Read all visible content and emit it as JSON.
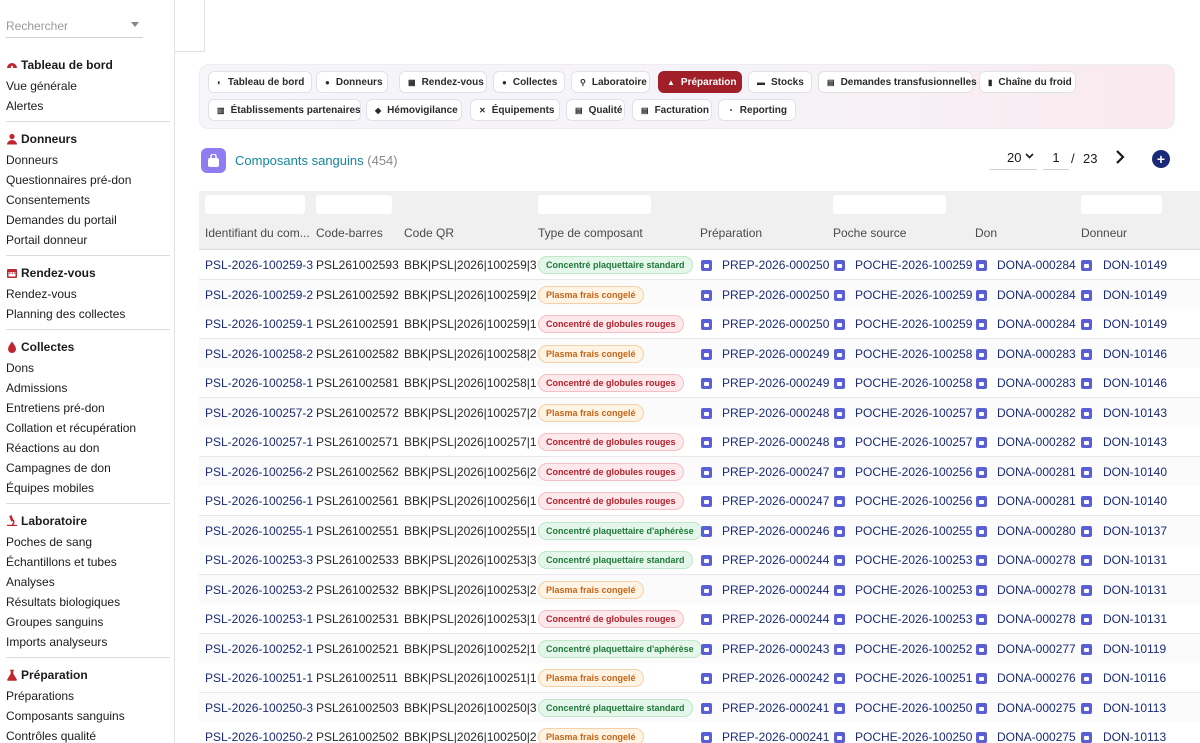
{
  "sidebar": {
    "search_placeholder": "Rechercher",
    "sections": [
      {
        "title": "Tableau de bord",
        "icon": "dashboard-icon",
        "items": [
          "Vue générale",
          "Alertes"
        ]
      },
      {
        "title": "Donneurs",
        "icon": "user-icon",
        "items": [
          "Donneurs",
          "Questionnaires pré-don",
          "Consentements",
          "Demandes du portail",
          "Portail donneur"
        ]
      },
      {
        "title": "Rendez-vous",
        "icon": "calendar-icon",
        "items": [
          "Rendez-vous",
          "Planning des collectes"
        ]
      },
      {
        "title": "Collectes",
        "icon": "drop-icon",
        "items": [
          "Dons",
          "Admissions",
          "Entretiens pré-don",
          "Collation et récupération",
          "Réactions au don",
          "Campagnes de don",
          "Équipes mobiles"
        ]
      },
      {
        "title": "Laboratoire",
        "icon": "microscope-icon",
        "items": [
          "Poches de sang",
          "Échantillons et tubes",
          "Analyses",
          "Résultats biologiques",
          "Groupes sanguins",
          "Imports analyseurs"
        ]
      },
      {
        "title": "Préparation",
        "icon": "flask-icon",
        "items": [
          "Préparations",
          "Composants sanguins",
          "Contrôles qualité"
        ]
      }
    ]
  },
  "nav": {
    "row1": [
      "Tableau de bord",
      "Donneurs",
      "Rendez-vous",
      "Collectes",
      "Laboratoire",
      "Préparation",
      "Stocks",
      "Demandes transfusionnelles",
      "Chaîne du froid"
    ],
    "row2": [
      "Établissements partenaires",
      "Hémovigilance",
      "Équipements",
      "Qualité",
      "Facturation",
      "Reporting"
    ],
    "active": "Préparation"
  },
  "page": {
    "title": "Composants sanguins",
    "count": "(454)",
    "page_size": "20",
    "current_page": "1",
    "slash": "/",
    "total_pages": "23",
    "add_label": "+"
  },
  "table": {
    "columns": [
      "Identifiant du com...",
      "Code-barres",
      "Code QR",
      "Type de composant",
      "Préparation",
      "Poche source",
      "Don",
      "Donneur"
    ],
    "rows": [
      {
        "id": "PSL-2026-100259-3",
        "barcode": "PSL261002593",
        "qr": "BBK|PSL|2026|100259|3",
        "type": "Concentré plaquettaire standard",
        "kind": "platelet",
        "prep": "PREP-2026-000250",
        "bag": "POCHE-2026-100259",
        "don": "DONA-000284",
        "donor": "DON-10149"
      },
      {
        "id": "PSL-2026-100259-2",
        "barcode": "PSL261002592",
        "qr": "BBK|PSL|2026|100259|2",
        "type": "Plasma frais congelé",
        "kind": "plasma",
        "prep": "PREP-2026-000250",
        "bag": "POCHE-2026-100259",
        "don": "DONA-000284",
        "donor": "DON-10149"
      },
      {
        "id": "PSL-2026-100259-1",
        "barcode": "PSL261002591",
        "qr": "BBK|PSL|2026|100259|1",
        "type": "Concentré de globules rouges",
        "kind": "rbc",
        "prep": "PREP-2026-000250",
        "bag": "POCHE-2026-100259",
        "don": "DONA-000284",
        "donor": "DON-10149"
      },
      {
        "id": "PSL-2026-100258-2",
        "barcode": "PSL261002582",
        "qr": "BBK|PSL|2026|100258|2",
        "type": "Plasma frais congelé",
        "kind": "plasma",
        "prep": "PREP-2026-000249",
        "bag": "POCHE-2026-100258",
        "don": "DONA-000283",
        "donor": "DON-10146"
      },
      {
        "id": "PSL-2026-100258-1",
        "barcode": "PSL261002581",
        "qr": "BBK|PSL|2026|100258|1",
        "type": "Concentré de globules rouges",
        "kind": "rbc",
        "prep": "PREP-2026-000249",
        "bag": "POCHE-2026-100258",
        "don": "DONA-000283",
        "donor": "DON-10146"
      },
      {
        "id": "PSL-2026-100257-2",
        "barcode": "PSL261002572",
        "qr": "BBK|PSL|2026|100257|2",
        "type": "Plasma frais congelé",
        "kind": "plasma",
        "prep": "PREP-2026-000248",
        "bag": "POCHE-2026-100257",
        "don": "DONA-000282",
        "donor": "DON-10143"
      },
      {
        "id": "PSL-2026-100257-1",
        "barcode": "PSL261002571",
        "qr": "BBK|PSL|2026|100257|1",
        "type": "Concentré de globules rouges",
        "kind": "rbc",
        "prep": "PREP-2026-000248",
        "bag": "POCHE-2026-100257",
        "don": "DONA-000282",
        "donor": "DON-10143"
      },
      {
        "id": "PSL-2026-100256-2",
        "barcode": "PSL261002562",
        "qr": "BBK|PSL|2026|100256|2",
        "type": "Concentré de globules rouges",
        "kind": "rbc",
        "prep": "PREP-2026-000247",
        "bag": "POCHE-2026-100256",
        "don": "DONA-000281",
        "donor": "DON-10140"
      },
      {
        "id": "PSL-2026-100256-1",
        "barcode": "PSL261002561",
        "qr": "BBK|PSL|2026|100256|1",
        "type": "Concentré de globules rouges",
        "kind": "rbc",
        "prep": "PREP-2026-000247",
        "bag": "POCHE-2026-100256",
        "don": "DONA-000281",
        "donor": "DON-10140"
      },
      {
        "id": "PSL-2026-100255-1",
        "barcode": "PSL261002551",
        "qr": "BBK|PSL|2026|100255|1",
        "type": "Concentré plaquettaire d'aphérèse",
        "kind": "platelet",
        "prep": "PREP-2026-000246",
        "bag": "POCHE-2026-100255",
        "don": "DONA-000280",
        "donor": "DON-10137"
      },
      {
        "id": "PSL-2026-100253-3",
        "barcode": "PSL261002533",
        "qr": "BBK|PSL|2026|100253|3",
        "type": "Concentré plaquettaire standard",
        "kind": "platelet",
        "prep": "PREP-2026-000244",
        "bag": "POCHE-2026-100253",
        "don": "DONA-000278",
        "donor": "DON-10131"
      },
      {
        "id": "PSL-2026-100253-2",
        "barcode": "PSL261002532",
        "qr": "BBK|PSL|2026|100253|2",
        "type": "Plasma frais congelé",
        "kind": "plasma",
        "prep": "PREP-2026-000244",
        "bag": "POCHE-2026-100253",
        "don": "DONA-000278",
        "donor": "DON-10131"
      },
      {
        "id": "PSL-2026-100253-1",
        "barcode": "PSL261002531",
        "qr": "BBK|PSL|2026|100253|1",
        "type": "Concentré de globules rouges",
        "kind": "rbc",
        "prep": "PREP-2026-000244",
        "bag": "POCHE-2026-100253",
        "don": "DONA-000278",
        "donor": "DON-10131"
      },
      {
        "id": "PSL-2026-100252-1",
        "barcode": "PSL261002521",
        "qr": "BBK|PSL|2026|100252|1",
        "type": "Concentré plaquettaire d'aphérèse",
        "kind": "platelet",
        "prep": "PREP-2026-000243",
        "bag": "POCHE-2026-100252",
        "don": "DONA-000277",
        "donor": "DON-10119"
      },
      {
        "id": "PSL-2026-100251-1",
        "barcode": "PSL261002511",
        "qr": "BBK|PSL|2026|100251|1",
        "type": "Plasma frais congelé",
        "kind": "plasma",
        "prep": "PREP-2026-000242",
        "bag": "POCHE-2026-100251",
        "don": "DONA-000276",
        "donor": "DON-10116"
      },
      {
        "id": "PSL-2026-100250-3",
        "barcode": "PSL261002503",
        "qr": "BBK|PSL|2026|100250|3",
        "type": "Concentré plaquettaire standard",
        "kind": "platelet",
        "prep": "PREP-2026-000241",
        "bag": "POCHE-2026-100250",
        "don": "DONA-000275",
        "donor": "DON-10113"
      },
      {
        "id": "PSL-2026-100250-2",
        "barcode": "PSL261002502",
        "qr": "BBK|PSL|2026|100250|2",
        "type": "Plasma frais congelé",
        "kind": "plasma",
        "prep": "PREP-2026-000241",
        "bag": "POCHE-2026-100250",
        "don": "DONA-000275",
        "donor": "DON-10113"
      }
    ]
  }
}
